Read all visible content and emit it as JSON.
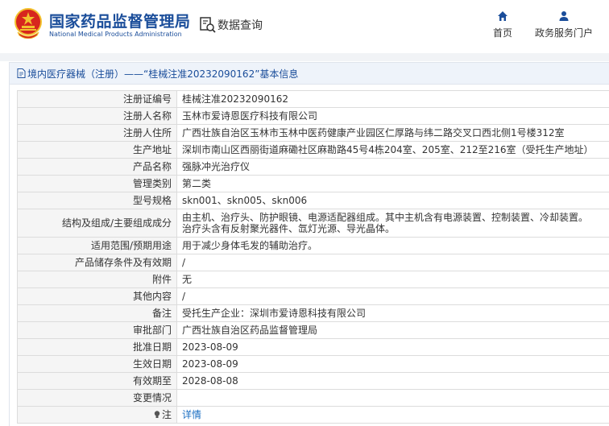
{
  "header": {
    "title": "国家药品监督管理局",
    "subtitle": "National Medical Products Administration",
    "query_label": "数据查询",
    "nav": [
      {
        "label": "首页",
        "icon": "home-icon"
      },
      {
        "label": "政务服务门户",
        "icon": "user-icon"
      }
    ]
  },
  "panel": {
    "heading": "境内医疗器械（注册）——“桂械注准20232090162”基本信息"
  },
  "rows": [
    {
      "label": "注册证编号",
      "value": "桂械注准20232090162"
    },
    {
      "label": "注册人名称",
      "value": "玉林市爱诗恩医疗科技有限公司"
    },
    {
      "label": "注册人住所",
      "value": "广西壮族自治区玉林市玉林中医药健康产业园区仁厚路与纬二路交叉口西北侧1号楼312室"
    },
    {
      "label": "生产地址",
      "value": "深圳市南山区西丽街道麻磡社区麻勘路45号4栋204室、205室、212至216室（受托生产地址）"
    },
    {
      "label": "产品名称",
      "value": "强脉冲光治疗仪"
    },
    {
      "label": "管理类别",
      "value": "第二类"
    },
    {
      "label": "型号规格",
      "value": "skn001、skn005、skn006"
    },
    {
      "label": "结构及组成/主要组成成分",
      "value": "由主机、治疗头、防护眼镜、电源适配器组成。其中主机含有电源装置、控制装置、冷却装置。",
      "value2": "治疗头含有反射聚光器件、氙灯光源、导光晶体。"
    },
    {
      "label": "适用范围/预期用途",
      "value": "用于减少身体毛发的辅助治疗。"
    },
    {
      "label": "产品储存条件及有效期",
      "value": "/"
    },
    {
      "label": "附件",
      "value": "无"
    },
    {
      "label": "其他内容",
      "value": "/"
    },
    {
      "label": "备注",
      "value": "受托生产企业：深圳市爱诗恩科技有限公司"
    },
    {
      "label": "审批部门",
      "value": "广西壮族自治区药品监督管理局"
    },
    {
      "label": "批准日期",
      "value": "2023-08-09"
    },
    {
      "label": "生效日期",
      "value": "2023-08-09"
    },
    {
      "label": "有效期至",
      "value": "2028-08-08"
    },
    {
      "label": "变更情况",
      "value": ""
    },
    {
      "label": "注",
      "value": "详情",
      "label_icon": "lightbulb-icon"
    }
  ],
  "colors": {
    "brand_blue": "#1a4d9a",
    "emblem_red": "#d7261e",
    "emblem_gold": "#f2c12e",
    "link_blue": "#1a6ec2"
  }
}
